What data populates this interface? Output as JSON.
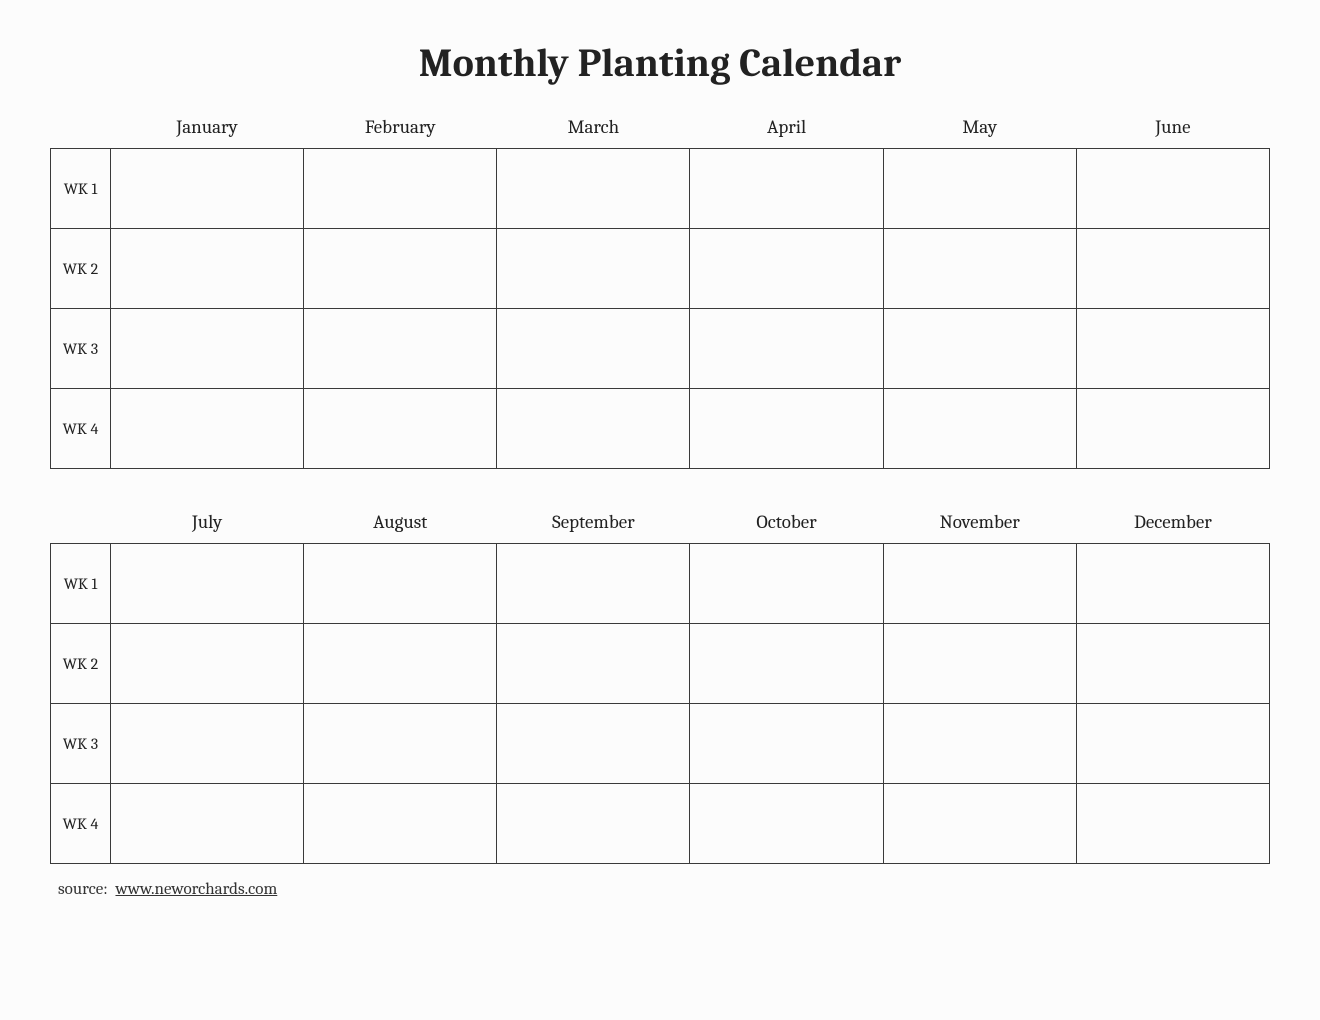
{
  "title": "Monthly Planting Calendar",
  "row_labels": [
    "WK 1",
    "WK 2",
    "WK 3",
    "WK 4"
  ],
  "blocks": [
    {
      "months": [
        "January",
        "February",
        "March",
        "April",
        "May",
        "June"
      ]
    },
    {
      "months": [
        "July",
        "August",
        "September",
        "October",
        "November",
        "December"
      ]
    }
  ],
  "source": {
    "label": "source:",
    "link_text": "www.neworchards.com"
  }
}
